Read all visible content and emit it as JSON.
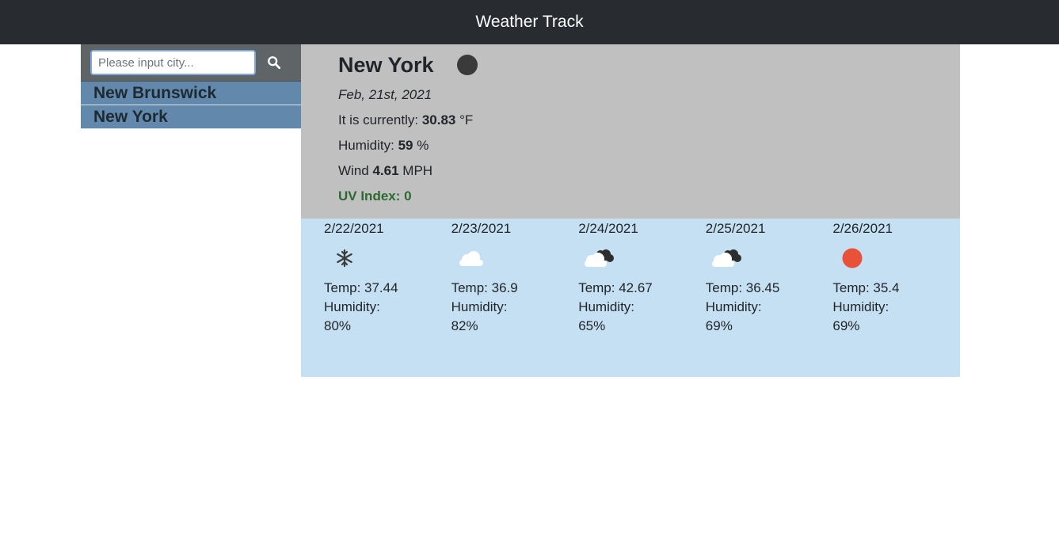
{
  "header": {
    "title": "Weather Track"
  },
  "search": {
    "placeholder": "Please input city...",
    "value": ""
  },
  "history": [
    {
      "label": "New Brunswick"
    },
    {
      "label": "New York"
    }
  ],
  "current": {
    "city": "New York",
    "icon": "moon-icon",
    "date": "Feb, 21st, 2021",
    "temp_prefix": "It is currently:",
    "temp_value": "30.83",
    "temp_unit": "°F",
    "humidity_prefix": "Humidity:",
    "humidity_value": "59",
    "humidity_unit": "%",
    "wind_prefix": "Wind",
    "wind_value": "4.61",
    "wind_unit": "MPH",
    "uv_label": "UV Index: 0"
  },
  "forecast": [
    {
      "date": "2/22/2021",
      "icon": "snowflake-icon",
      "temp": "Temp: 37.44",
      "humidity_label": "Humidity:",
      "humidity": "80%"
    },
    {
      "date": "2/23/2021",
      "icon": "cloud-icon",
      "temp": "Temp: 36.9",
      "humidity_label": "Humidity:",
      "humidity": "82%"
    },
    {
      "date": "2/24/2021",
      "icon": "broken-clouds-icon",
      "temp": "Temp: 42.67",
      "humidity_label": "Humidity:",
      "humidity": "65%"
    },
    {
      "date": "2/25/2021",
      "icon": "broken-clouds-icon",
      "temp": "Temp: 36.45",
      "humidity_label": "Humidity:",
      "humidity": "69%"
    },
    {
      "date": "2/26/2021",
      "icon": "sun-icon",
      "temp": "Temp: 35.4",
      "humidity_label": "Humidity:",
      "humidity": "69%"
    }
  ],
  "colors": {
    "navbar": "#282c30",
    "sidebar_item": "#6289ab",
    "current_bg": "#c0c0c1",
    "forecast_bg": "#c5e0f2",
    "uv_green": "#2d6a2f",
    "sun": "#e8513a"
  }
}
